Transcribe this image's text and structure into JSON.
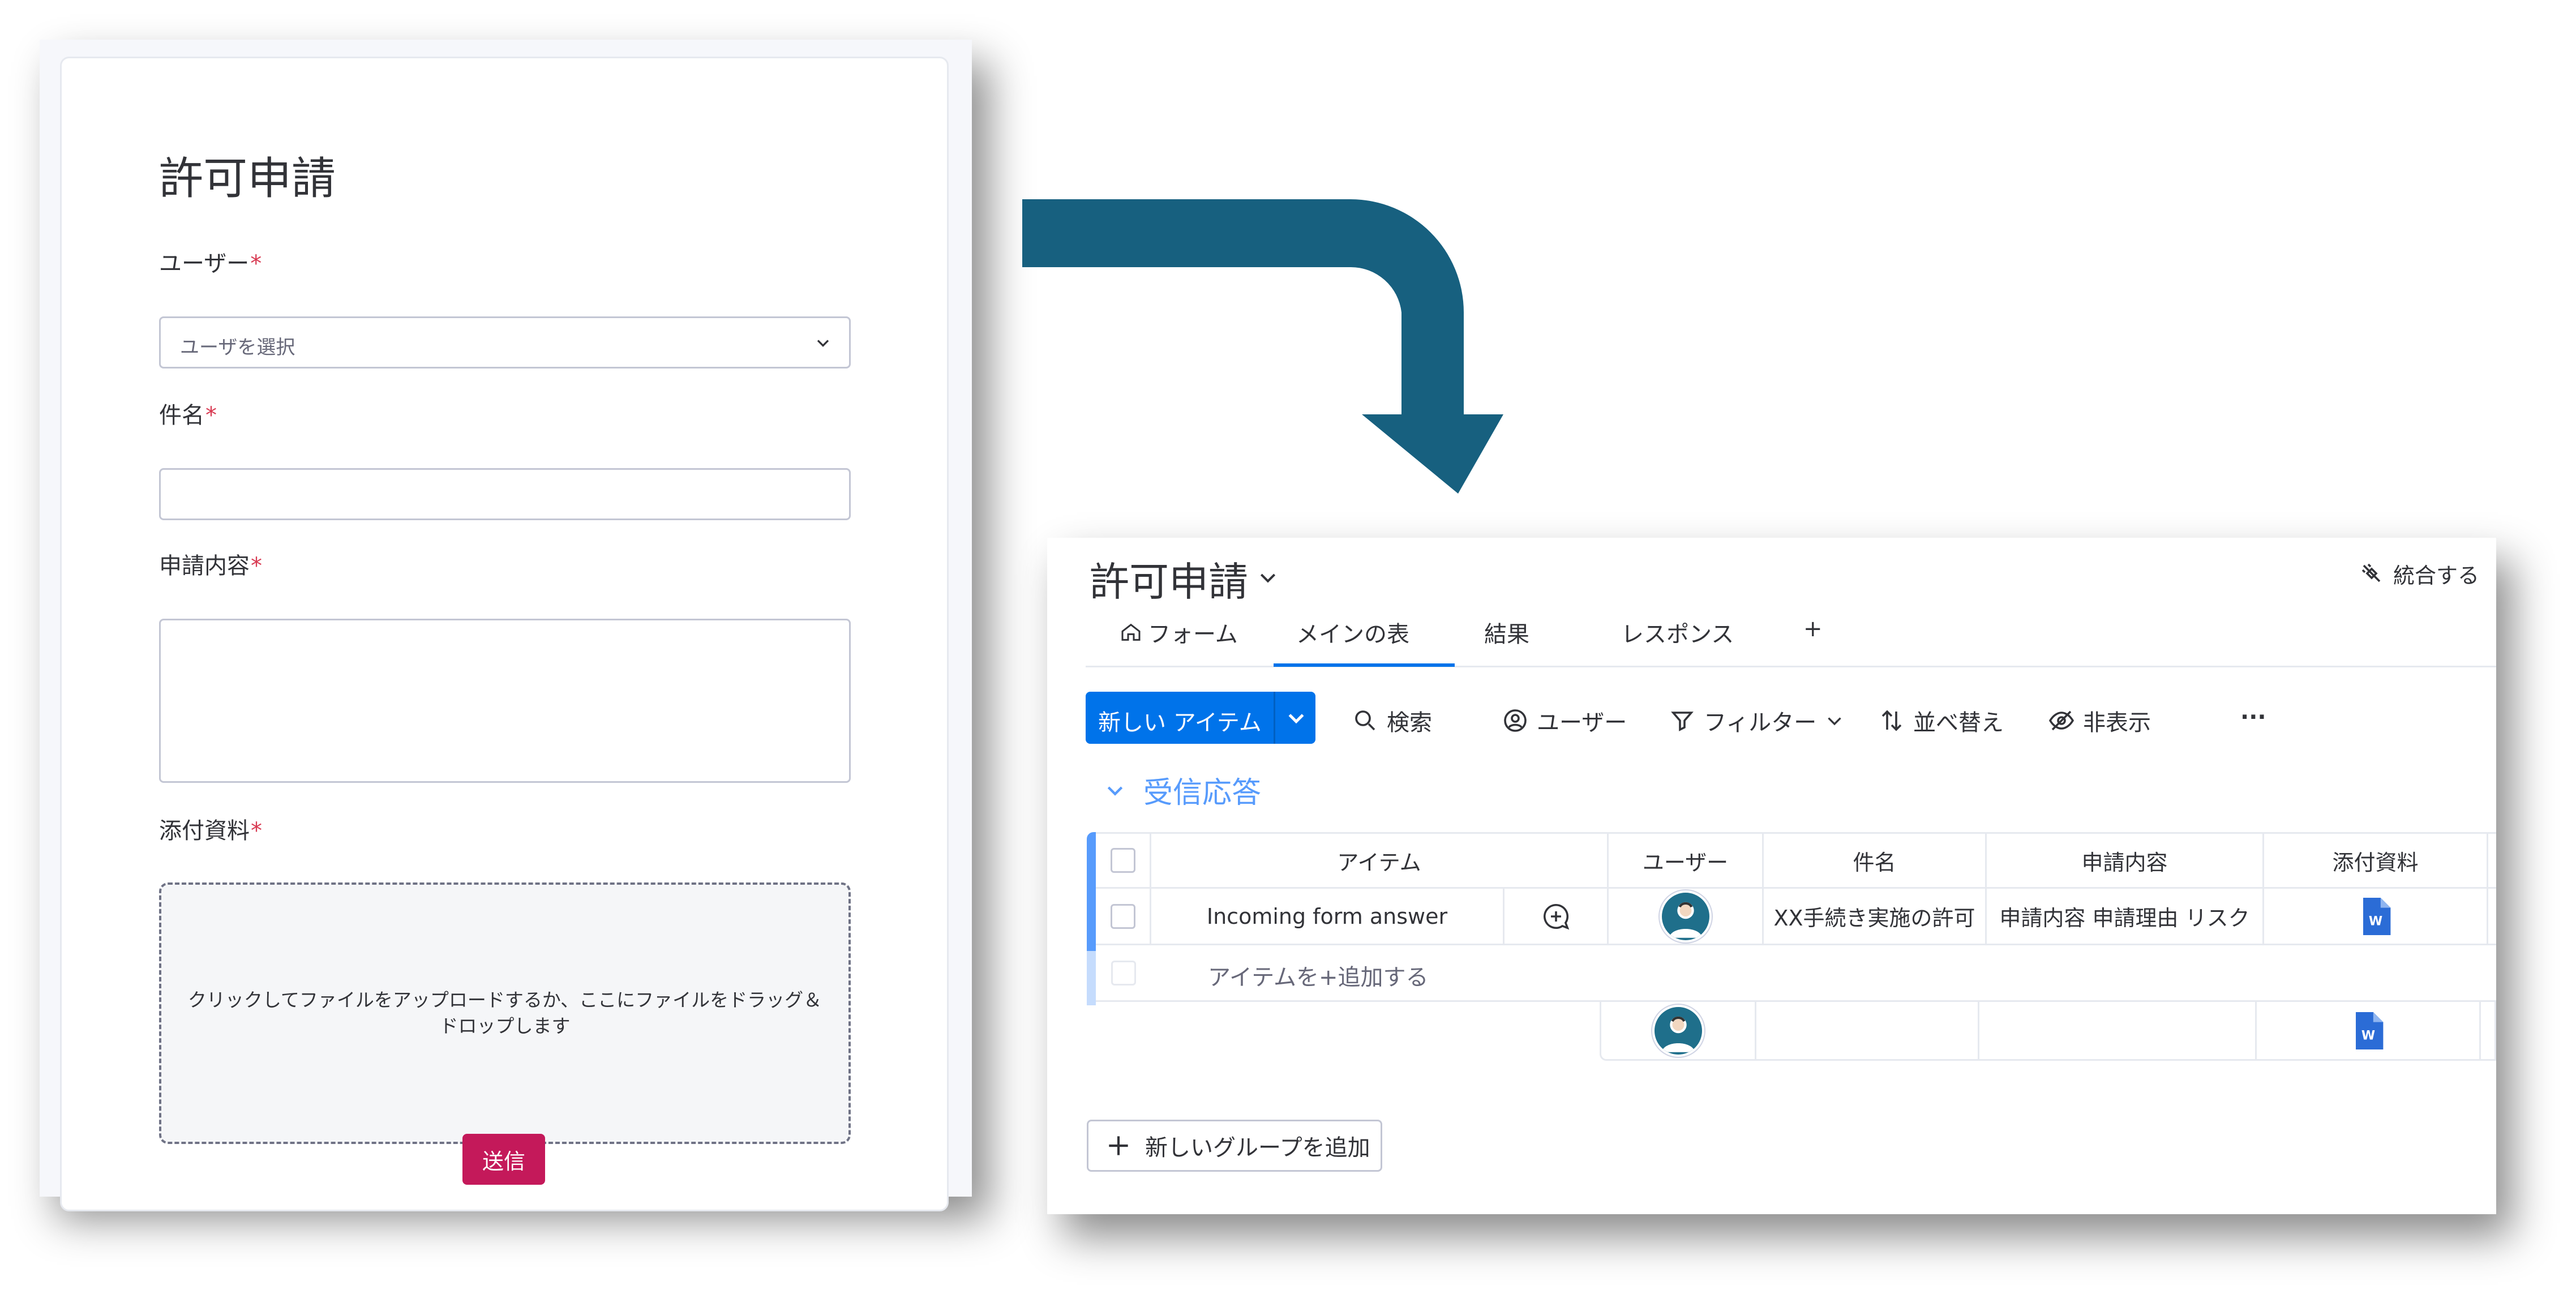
{
  "form": {
    "title": "許可申請",
    "required_mark": "*",
    "user_label": "ユーザー",
    "user_placeholder": "ユーザを選択",
    "subject_label": "件名",
    "content_label": "申請内容",
    "attachment_label": "添付資料",
    "dropzone_text": "クリックしてファイルをアップロードするか、ここにファイルをドラッグ＆ドロップします",
    "submit_label": "送信",
    "accent_color": "#c4195a"
  },
  "board": {
    "title": "許可申請",
    "integrate_label": "統合する",
    "tabs": [
      {
        "label": "フォーム",
        "icon": "home-icon"
      },
      {
        "label": "メインの表",
        "active": true
      },
      {
        "label": "結果"
      },
      {
        "label": "レスポンス"
      },
      {
        "label": "+"
      }
    ],
    "toolbar": {
      "new_item_label": "新しい アイテム",
      "search_label": "検索",
      "user_label": "ユーザー",
      "filter_label": "フィルター",
      "sort_label": "並べ替え",
      "hide_label": "非表示",
      "more_label": "···"
    },
    "group": {
      "name": "受信応答",
      "color": "#579bfc"
    },
    "columns": [
      "アイテム",
      "ユーザー",
      "件名",
      "申請内容",
      "添付資料"
    ],
    "rows": [
      {
        "item": "Incoming form answer",
        "user_avatar": "avatar-icon",
        "subject": "XX手続き実施の許可",
        "content": "申請内容 申請理由 リスク",
        "attachment_icon": "word-file-icon"
      }
    ],
    "add_item_label": "アイテムを+追加する",
    "add_group_label": "新しいグループを追加",
    "primary_color": "#0073ea"
  },
  "arrow_color": "#17607f"
}
